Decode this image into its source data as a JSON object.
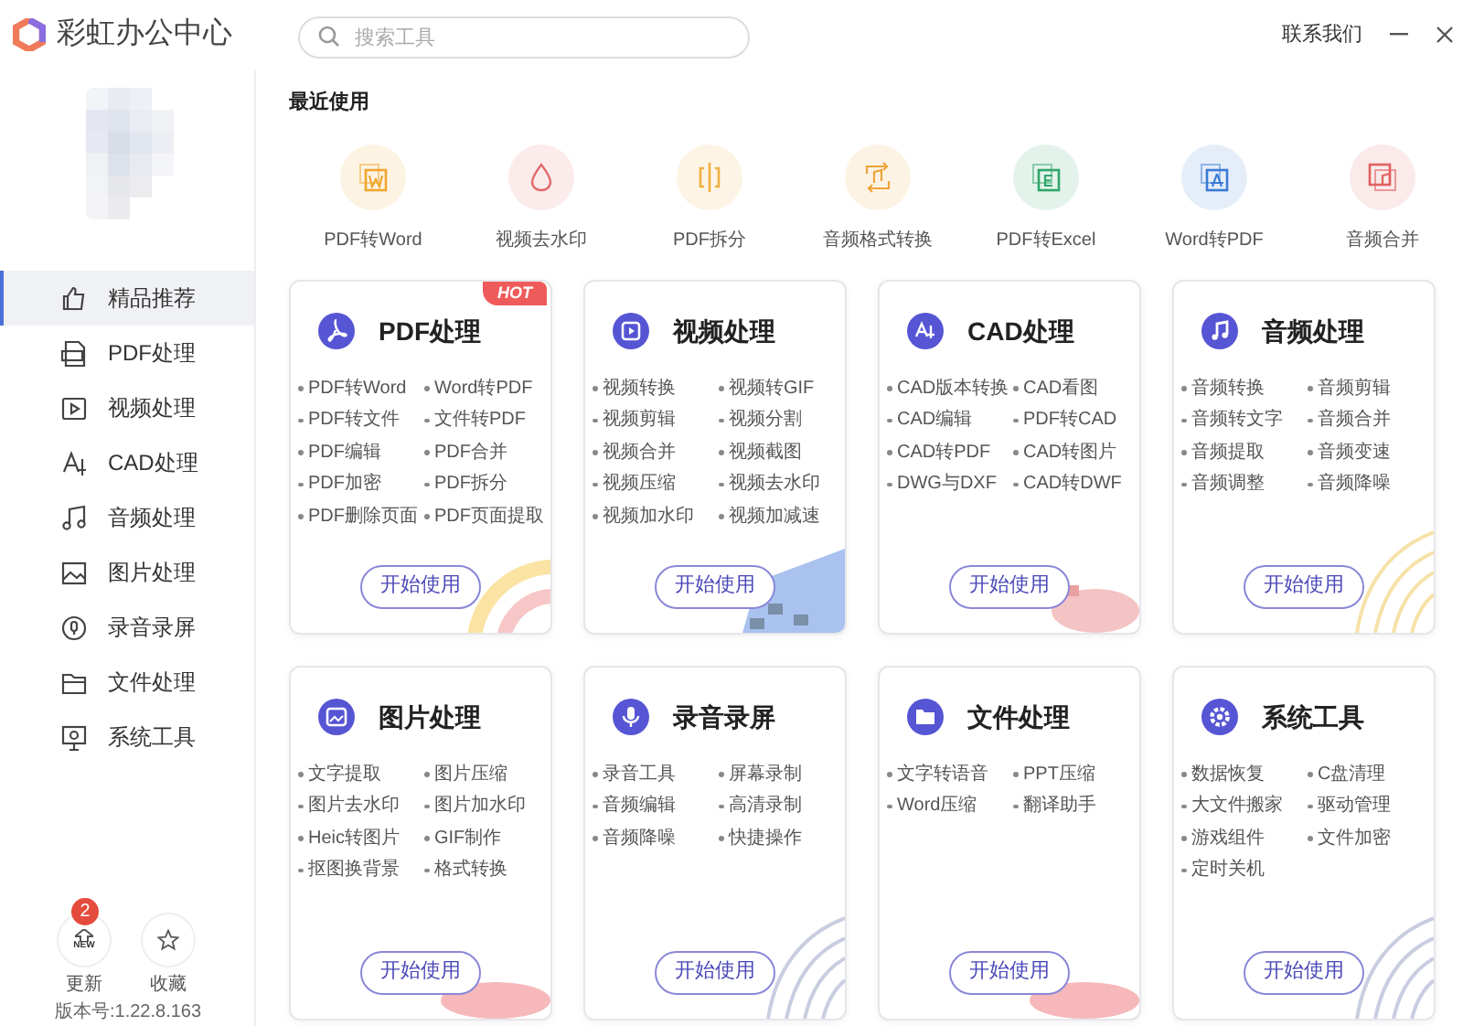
{
  "app": {
    "title": "彩虹办公中心"
  },
  "search": {
    "placeholder": "搜索工具"
  },
  "header": {
    "contact": "联系我们"
  },
  "sidebar": {
    "items": [
      {
        "label": "精品推荐",
        "selected": true
      },
      {
        "label": "PDF处理",
        "selected": false
      },
      {
        "label": "视频处理",
        "selected": false
      },
      {
        "label": "CAD处理",
        "selected": false
      },
      {
        "label": "音频处理",
        "selected": false
      },
      {
        "label": "图片处理",
        "selected": false
      },
      {
        "label": "录音录屏",
        "selected": false
      },
      {
        "label": "文件处理",
        "selected": false
      },
      {
        "label": "系统工具",
        "selected": false
      }
    ],
    "update": {
      "label": "更新",
      "icon_label": "NEW",
      "badge": "2"
    },
    "favorite": {
      "label": "收藏"
    },
    "version": "版本号:1.22.8.163"
  },
  "recent": {
    "title": "最近使用",
    "items": [
      {
        "label": "PDF转Word",
        "color": "#f0a630"
      },
      {
        "label": "视频去水印",
        "color": "#e06c6c"
      },
      {
        "label": "PDF拆分",
        "color": "#f0b040"
      },
      {
        "label": "音频格式转换",
        "color": "#eda53a"
      },
      {
        "label": "PDF转Excel",
        "color": "#2fa66a"
      },
      {
        "label": "Word转PDF",
        "color": "#3a7bd5"
      },
      {
        "label": "音频合并",
        "color": "#e06060"
      }
    ]
  },
  "cards": [
    {
      "title": "PDF处理",
      "badge": "HOT",
      "tools": [
        "PDF转Word",
        "Word转PDF",
        "PDF转文件",
        "文件转PDF",
        "PDF编辑",
        "PDF合并",
        "PDF加密",
        "PDF拆分",
        "PDF删除页面",
        "PDF页面提取"
      ],
      "button": "开始使用"
    },
    {
      "title": "视频处理",
      "tools": [
        "视频转换",
        "视频转GIF",
        "视频剪辑",
        "视频分割",
        "视频合并",
        "视频截图",
        "视频压缩",
        "视频去水印",
        "视频加水印",
        "视频加减速"
      ],
      "button": "开始使用"
    },
    {
      "title": "CAD处理",
      "tools": [
        "CAD版本转换",
        "CAD看图",
        "CAD编辑",
        "PDF转CAD",
        "CAD转PDF",
        "CAD转图片",
        "DWG与DXF",
        "CAD转DWF"
      ],
      "button": "开始使用"
    },
    {
      "title": "音频处理",
      "tools": [
        "音频转换",
        "音频剪辑",
        "音频转文字",
        "音频合并",
        "音频提取",
        "音频变速",
        "音频调整",
        "音频降噪"
      ],
      "button": "开始使用"
    },
    {
      "title": "图片处理",
      "tools": [
        "文字提取",
        "图片压缩",
        "图片去水印",
        "图片加水印",
        "Heic转图片",
        "GIF制作",
        "抠图换背景",
        "格式转换"
      ],
      "button": "开始使用"
    },
    {
      "title": "录音录屏",
      "tools": [
        "录音工具",
        "屏幕录制",
        "音频编辑",
        "高清录制",
        "音频降噪",
        "快捷操作"
      ],
      "button": "开始使用"
    },
    {
      "title": "文件处理",
      "tools": [
        "文字转语音",
        "PPT压缩",
        "Word压缩",
        "翻译助手"
      ],
      "button": "开始使用"
    },
    {
      "title": "系统工具",
      "tools": [
        "数据恢复",
        "C盘清理",
        "大文件搬家",
        "驱动管理",
        "游戏组件",
        "文件加密",
        "定时关机"
      ],
      "button": "开始使用"
    }
  ]
}
